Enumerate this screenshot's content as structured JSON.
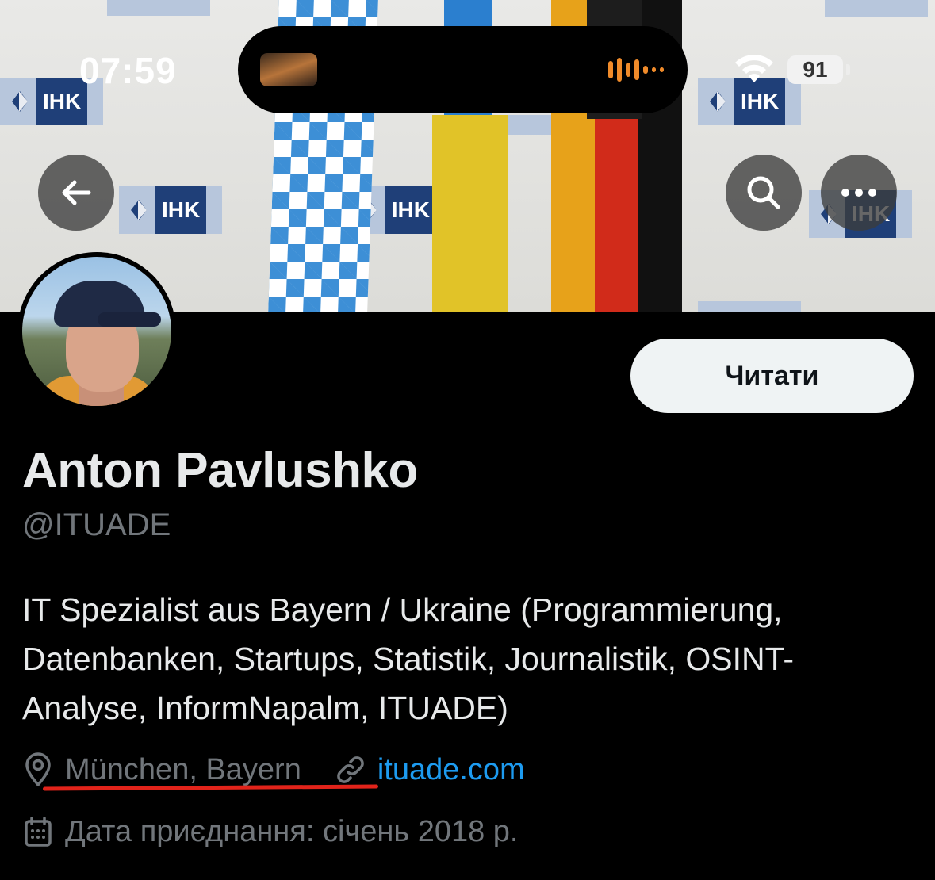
{
  "status_bar": {
    "time": "07:59",
    "battery": "91",
    "icons": [
      "album-art-thumbnail",
      "audio-waveform-icon",
      "wifi-icon",
      "battery-icon"
    ]
  },
  "banner": {
    "logo_text": "IHK",
    "actions": {
      "back_icon": "arrow-left-icon",
      "search_icon": "search-icon",
      "more_icon": "more-dots-icon"
    }
  },
  "profile": {
    "follow_label": "Читати",
    "name": "Anton Pavlushko",
    "handle": "@ITUADE",
    "bio": "IT Spezialist aus Bayern / Ukraine (Programmierung, Datenbanken, Startups, Statistik, Journalistik, OSINT-Analyse, InformNapalm, ITUADE)",
    "location": "München, Bayern",
    "website": "ituade.com",
    "joined": "Дата приєднання: січень 2018 р."
  },
  "colors": {
    "background": "#000000",
    "text_primary": "#e7e9ea",
    "text_secondary": "#71767b",
    "link": "#1d9bf0",
    "follow_button_bg": "#eff3f4",
    "annotation_underline": "#e2231a",
    "waveform": "#f08b2a"
  }
}
